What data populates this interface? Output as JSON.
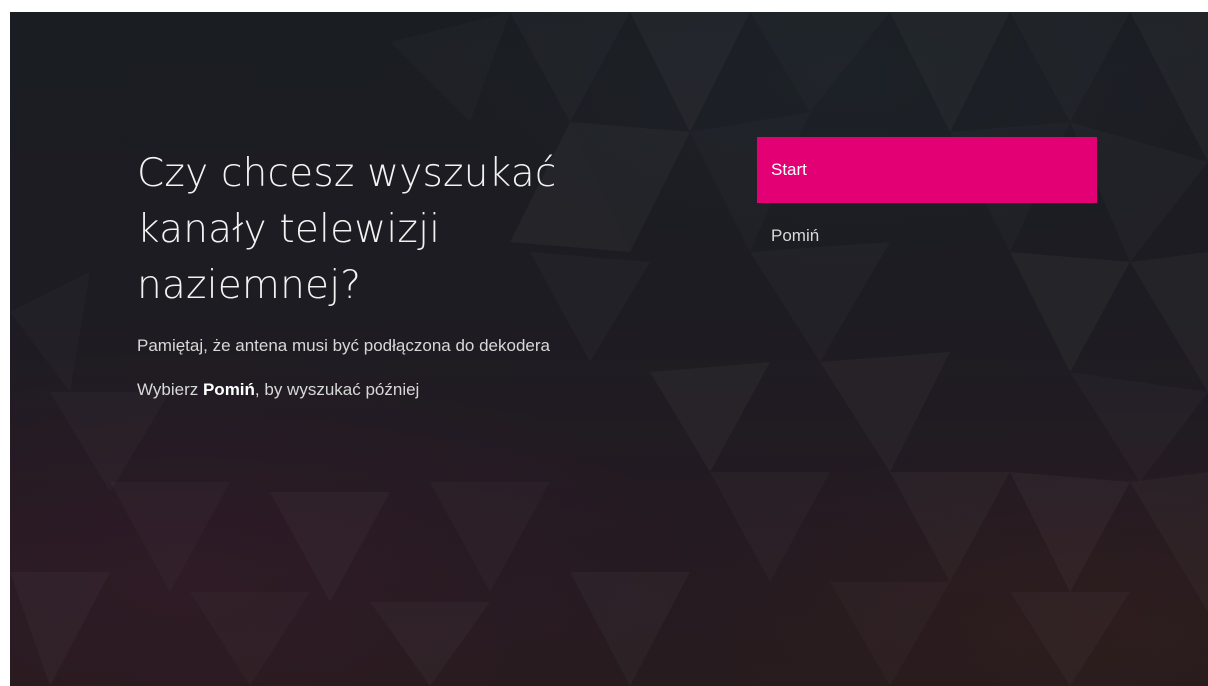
{
  "dialog": {
    "title": "Czy chcesz wyszukać kanały telewizji naziemnej?",
    "hint_antenna": "Pamiętaj, że antena musi być podłączona do dekodera",
    "hint_skip_prefix": "Wybierz ",
    "hint_skip_bold": "Pomiń",
    "hint_skip_suffix": ", by wyszukać później"
  },
  "menu": {
    "items": [
      {
        "label": "Start",
        "selected": true
      },
      {
        "label": "Pomiń",
        "selected": false
      }
    ]
  },
  "colors": {
    "accent": "#e20074",
    "background": "#1c1c22",
    "text": "#f2f2f2"
  }
}
